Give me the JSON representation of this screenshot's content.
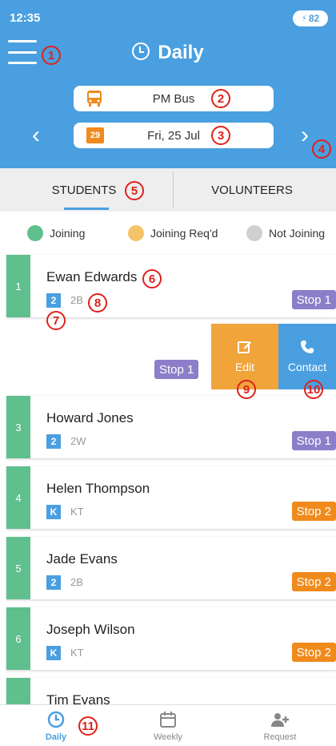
{
  "status": {
    "time": "12:35",
    "battery": "82"
  },
  "header": {
    "title": "Daily",
    "bus_label": "PM Bus",
    "date_badge": "29",
    "date_label": "Fri, 25 Jul"
  },
  "tabs": [
    {
      "label": "STUDENTS"
    },
    {
      "label": "VOLUNTEERS"
    }
  ],
  "legend": [
    {
      "label": "Joining",
      "color": "#5fbf8d"
    },
    {
      "label": "Joining Req'd",
      "color": "#f5c46a"
    },
    {
      "label": "Not Joining",
      "color": "#d0d0d0"
    }
  ],
  "students": [
    {
      "index": "1",
      "name": "Ewan Edwards",
      "grade": "2",
      "class": "2B",
      "stop": "Stop 1"
    },
    {
      "stop": "Stop 1"
    },
    {
      "index": "3",
      "name": "Howard Jones",
      "grade": "2",
      "class": "2W",
      "stop": "Stop 1"
    },
    {
      "index": "4",
      "name": "Helen Thompson",
      "grade": "K",
      "class": "KT",
      "stop": "Stop 2"
    },
    {
      "index": "5",
      "name": "Jade Evans",
      "grade": "2",
      "class": "2B",
      "stop": "Stop 2"
    },
    {
      "index": "6",
      "name": "Joseph Wilson",
      "grade": "K",
      "class": "KT",
      "stop": "Stop 2"
    },
    {
      "name": "Tim Evans"
    }
  ],
  "actions": {
    "edit": "Edit",
    "contact": "Contact"
  },
  "nav": [
    {
      "label": "Daily"
    },
    {
      "label": "Weekly"
    },
    {
      "label": "Request"
    }
  ],
  "markers": [
    "1",
    "2",
    "3",
    "4",
    "5",
    "6",
    "7",
    "8",
    "9",
    "10",
    "11"
  ]
}
